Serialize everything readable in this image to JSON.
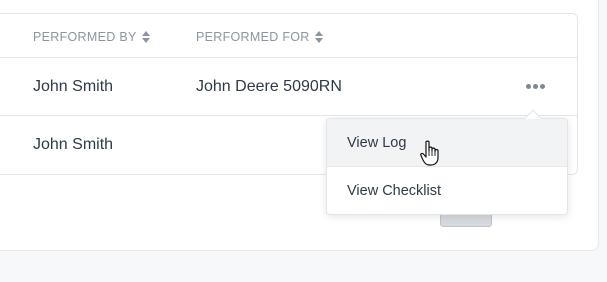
{
  "table": {
    "columns": [
      {
        "label": "PERFORMED BY",
        "sortable": true
      },
      {
        "label": "PERFORMED FOR",
        "sortable": true
      }
    ],
    "rows": [
      {
        "performed_by": "John Smith",
        "performed_for": "John Deere 5090RN"
      },
      {
        "performed_by": "John Smith",
        "performed_for": ""
      }
    ]
  },
  "menu": {
    "trigger_icon": "more-horizontal-icon",
    "items": [
      {
        "label": "View Log",
        "highlighted": true
      },
      {
        "label": "View Checklist",
        "highlighted": false
      }
    ]
  },
  "colors": {
    "header_text": "#8c96a3",
    "body_text": "#2e3a47",
    "hover_bg": "#f2f3f5",
    "border": "#e4e7ea"
  }
}
